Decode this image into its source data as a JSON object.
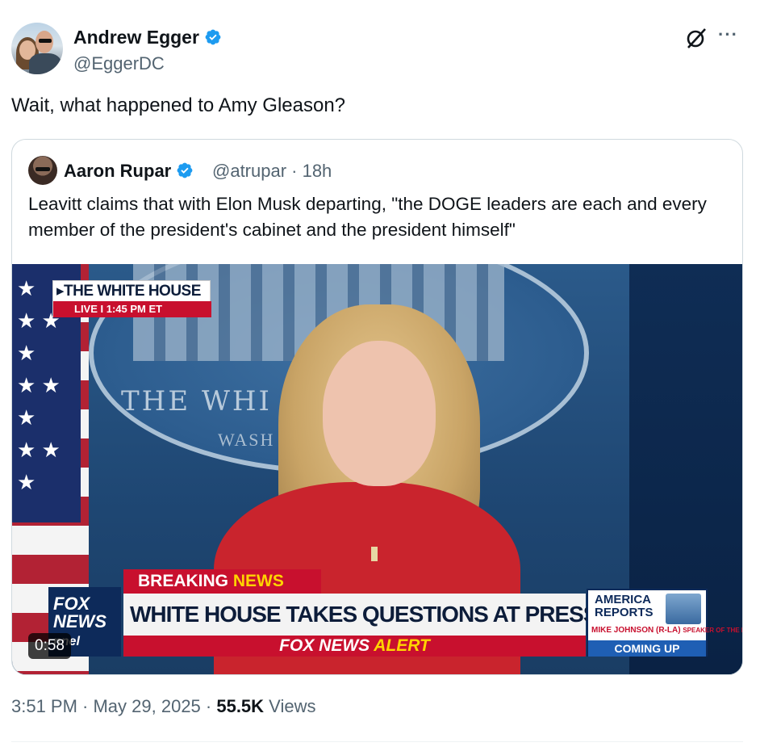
{
  "post": {
    "author_name": "Andrew Egger",
    "author_handle": "@EggerDC",
    "text": "Wait, what happened to Amy Gleason?",
    "timestamp": "3:51 PM · May 29, 2025 · ",
    "views_count": "55.5K",
    "views_label": " Views",
    "icons": [
      "verified-badge",
      "grok-icon",
      "more-icon"
    ]
  },
  "quoted": {
    "author_name": "Aaron Rupar",
    "meta": "@atrupar · 18h",
    "text": "Leavitt claims that with Elon Musk departing, \"the DOGE leaders are each and every member of the president's cabinet and the president himself\"",
    "video": {
      "duration": "0:58",
      "bug_title": "THE WHITE HOUSE",
      "bug_live": "LIVE  I  1:45 PM ET",
      "breaking_prefix": "BREAKING ",
      "breaking_suffix": "NEWS",
      "headline": "WHITE HOUSE TAKES QUESTIONS AT PRESS BRIEFING",
      "alert_prefix": "FOX NEWS ",
      "alert_suffix": "ALERT",
      "network_logo": "FOX NEWS",
      "network_logo_tail": "nnel",
      "promo_title": "AMERICA REPORTS",
      "promo_guest": "MIKE JOHNSON (R-LA)",
      "promo_guest_role": "SPEAKER OF THE HOUSE",
      "promo_cta": "COMING UP",
      "backdrop_text": "THE WHI      SE",
      "backdrop_sub": "WASH"
    }
  },
  "colors": {
    "verified_blue": "#1d9bf0",
    "secondary_text": "#536471",
    "fox_red": "#c8102e",
    "fox_navy": "#0d2a5a"
  }
}
